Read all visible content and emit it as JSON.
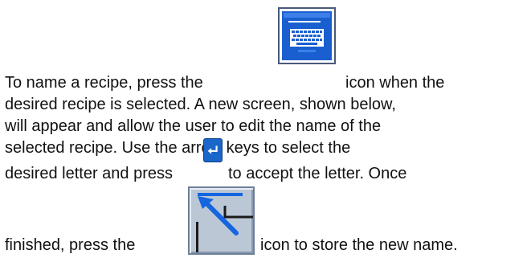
{
  "instructions": {
    "line1_before": "To name a recipe, press the",
    "line1_after": "icon when the",
    "line2": "desired recipe is selected. A new screen, shown below,",
    "line3": "will appear and allow the user to edit the name of the",
    "line4": "selected recipe. Use the arrow keys to select the",
    "line5_before": "desired letter and press",
    "line5_after": "to accept the letter. Once",
    "line6_before": "finished, press the",
    "line6_after": "icon to store the new name."
  },
  "icons": {
    "keyboard": "keyboard-icon",
    "enter": "enter-icon",
    "store": "store-icon"
  },
  "colors": {
    "keyboard_blue": "#1a5fd0",
    "enter_blue": "#1a66c9",
    "store_gray": "#bcc7d6",
    "store_arrow": "#1565e0"
  }
}
